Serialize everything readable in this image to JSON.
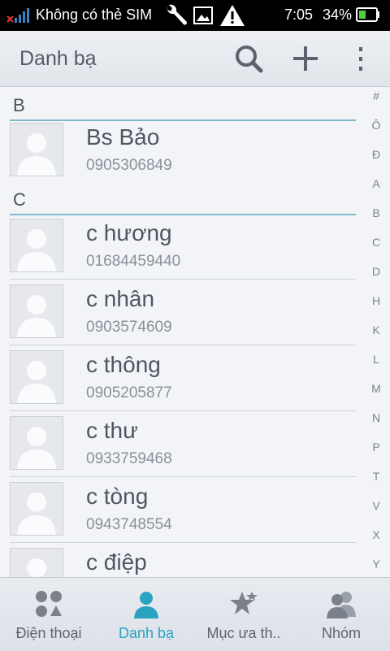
{
  "status_bar": {
    "carrier": "Không có thẻ SIM",
    "time": "7:05",
    "battery": "34%"
  },
  "action_bar": {
    "title": "Danh bạ"
  },
  "sections": [
    {
      "letter": "B",
      "contacts": [
        {
          "name": "Bs Bảo",
          "phone": "0905306849"
        }
      ]
    },
    {
      "letter": "C",
      "contacts": [
        {
          "name": "c hương",
          "phone": "01684459440"
        },
        {
          "name": "c nhân",
          "phone": "0903574609"
        },
        {
          "name": "c thông",
          "phone": "0905205877"
        },
        {
          "name": "c thư",
          "phone": "0933759468"
        },
        {
          "name": "c tòng",
          "phone": "0943748554"
        },
        {
          "name": "c điệp",
          "phone": ""
        }
      ]
    }
  ],
  "index_letters": [
    "#",
    "Ô",
    "Đ",
    "A",
    "B",
    "C",
    "D",
    "H",
    "K",
    "L",
    "M",
    "N",
    "P",
    "T",
    "V",
    "X",
    "Y"
  ],
  "tabs": [
    {
      "label": "Điện thoại",
      "icon": "dialpad-icon"
    },
    {
      "label": "Danh bạ",
      "icon": "person-icon",
      "active": true
    },
    {
      "label": "Mục ưa th..",
      "icon": "star-icon"
    },
    {
      "label": "Nhóm",
      "icon": "group-icon"
    }
  ],
  "colors": {
    "accent": "#2aa3c0",
    "section_line": "#7fb7cc",
    "text": "#4e5663"
  }
}
